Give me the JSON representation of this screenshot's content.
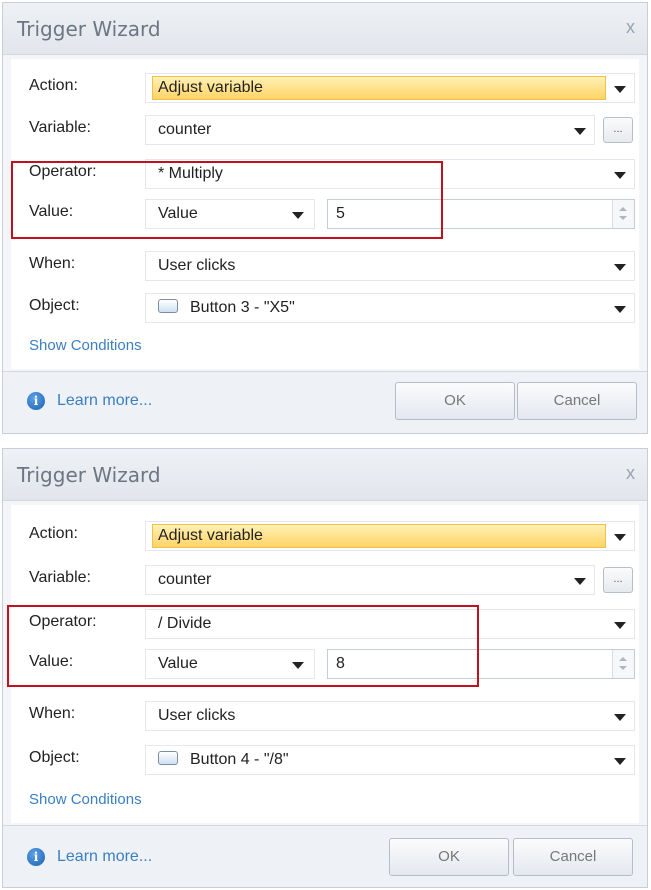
{
  "dialogs": [
    {
      "title": "Trigger Wizard",
      "close_glyph": "x",
      "labels": {
        "action": "Action:",
        "variable": "Variable:",
        "operator": "Operator:",
        "value": "Value:",
        "when": "When:",
        "object": "Object:"
      },
      "action_value": "Adjust variable",
      "variable_value": "counter",
      "variable_button": "...",
      "operator_value": "* Multiply",
      "value_type": "Value",
      "value_number": "5",
      "when_value": "User clicks",
      "object_value": "Button 3 - \"X5\"",
      "show_conditions": "Show Conditions",
      "learn_more": "Learn more...",
      "info_glyph": "i",
      "ok_label": "OK",
      "cancel_label": "Cancel"
    },
    {
      "title": "Trigger Wizard",
      "close_glyph": "x",
      "labels": {
        "action": "Action:",
        "variable": "Variable:",
        "operator": "Operator:",
        "value": "Value:",
        "when": "When:",
        "object": "Object:"
      },
      "action_value": "Adjust variable",
      "variable_value": "counter",
      "variable_button": "...",
      "operator_value": "/ Divide",
      "value_type": "Value",
      "value_number": "8",
      "when_value": "User clicks",
      "object_value": "Button 4 - \"/8\"",
      "show_conditions": "Show Conditions",
      "learn_more": "Learn more...",
      "info_glyph": "i",
      "ok_label": "OK",
      "cancel_label": "Cancel"
    }
  ],
  "colors": {
    "highlight_box": "#c0121e",
    "link": "#3a7fc4",
    "action_highlight": "#ffd466"
  }
}
